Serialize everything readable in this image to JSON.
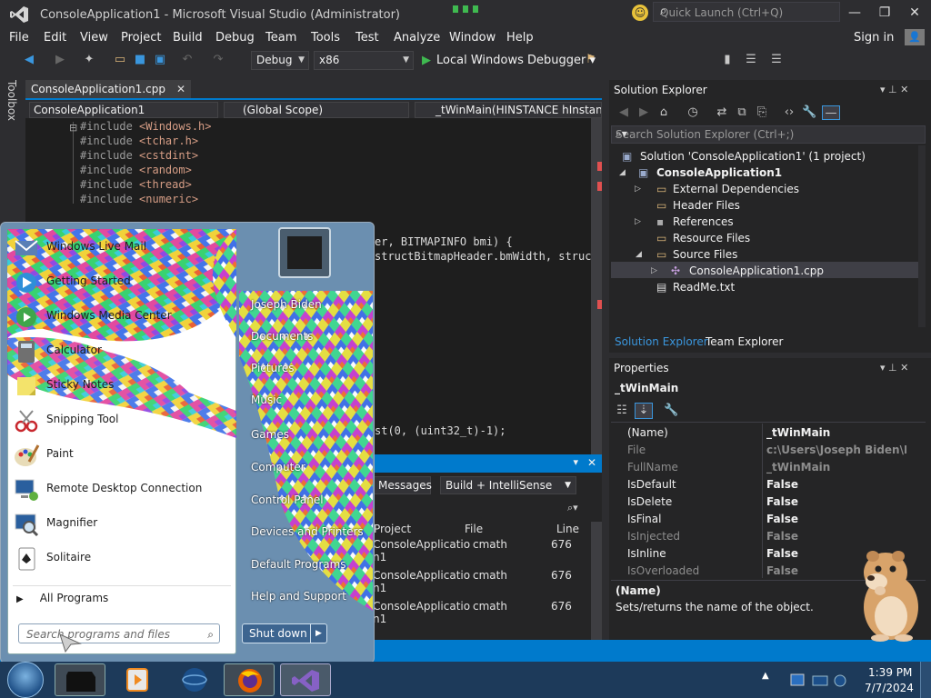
{
  "window": {
    "title": "ConsoleApplication1 - Microsoft Visual Studio (Administrator)",
    "quick_launch_placeholder": "Quick Launch (Ctrl+Q)",
    "sign_in": "Sign in"
  },
  "menu": [
    "File",
    "Edit",
    "View",
    "Project",
    "Build",
    "Debug",
    "Team",
    "Tools",
    "Test",
    "Analyze",
    "Window",
    "Help"
  ],
  "toolbar": {
    "config": "Debug",
    "platform": "x86",
    "debugger": "Local Windows Debugger"
  },
  "toolbox_label": "Toolbox",
  "editor": {
    "tab": "ConsoleApplication1.cpp",
    "nav_project": "ConsoleApplication1",
    "nav_scope": "(Global Scope)",
    "nav_function": "_tWinMain(HINSTANCE hInstanc",
    "lines": [
      {
        "kw": "#include",
        "arg": " <Windows.h>"
      },
      {
        "kw": "#include",
        "arg": " <tchar.h>"
      },
      {
        "kw": "#include",
        "arg": " <cstdint>"
      },
      {
        "kw": "#include",
        "arg": " <random>"
      },
      {
        "kw": "#include",
        "arg": " <thread>"
      },
      {
        "kw": "#include",
        "arg": " <numeric>"
      }
    ],
    "fragment1": "er, BITMAPINFO bmi) {",
    "fragment2": "structBitmapHeader.bmWidth, struct",
    "fragment3": "st(0, (uint32_t)-1);"
  },
  "error_list": {
    "tab_messages": "Messages",
    "filter": "Build + IntelliSense",
    "columns": [
      "Project",
      "File",
      "Line"
    ],
    "rows": [
      {
        "project": "ConsoleApplicatio",
        "project2": "n1",
        "file": "cmath",
        "line": "676"
      },
      {
        "project": "ConsoleApplicatio",
        "project2": "n1",
        "file": "cmath",
        "line": "676"
      },
      {
        "project": "ConsoleApplicatio",
        "project2": "n1",
        "file": "cmath",
        "line": "676"
      }
    ]
  },
  "solution_explorer": {
    "title": "Solution Explorer",
    "search_placeholder": "Search Solution Explorer (Ctrl+;)",
    "solution": "Solution 'ConsoleApplication1' (1 project)",
    "project": "ConsoleApplication1",
    "nodes": [
      "External Dependencies",
      "Header Files",
      "References",
      "Resource Files",
      "Source Files"
    ],
    "source_file": "ConsoleApplication1.cpp",
    "readme": "ReadMe.txt",
    "bottom_tabs": [
      "Solution Explorer",
      "Team Explorer"
    ]
  },
  "properties": {
    "title": "Properties",
    "object": "_tWinMain",
    "rows": [
      {
        "name": "(Name)",
        "value": "_tWinMain",
        "dim": false
      },
      {
        "name": "File",
        "value": "c:\\Users\\Joseph Biden\\Docu",
        "dim": true
      },
      {
        "name": "FullName",
        "value": "_tWinMain",
        "dim": true
      },
      {
        "name": "IsDefault",
        "value": "False",
        "dim": false
      },
      {
        "name": "IsDelete",
        "value": "False",
        "dim": false
      },
      {
        "name": "IsFinal",
        "value": "False",
        "dim": false
      },
      {
        "name": "IsInjected",
        "value": "False",
        "dim": true
      },
      {
        "name": "IsInline",
        "value": "False",
        "dim": false
      },
      {
        "name": "IsOverloaded",
        "value": "False",
        "dim": true
      }
    ],
    "desc_title": "(Name)",
    "desc_text": "Sets/returns the name of the object."
  },
  "start_menu": {
    "programs": [
      "Windows Live Mail",
      "Getting Started",
      "Windows Media Center",
      "Calculator",
      "Sticky Notes",
      "Snipping Tool",
      "Paint",
      "Remote Desktop Connection",
      "Magnifier",
      "Solitaire"
    ],
    "right_items": [
      "Joseph Biden",
      "Documents",
      "Pictures",
      "Music",
      "Games",
      "Computer",
      "Control Panel",
      "Devices and Printers",
      "Default Programs",
      "Help and Support"
    ],
    "all_programs": "All Programs",
    "search_placeholder": "Search programs and files",
    "shutdown": "Shut down"
  },
  "taskbar": {
    "time": "1:39 PM",
    "date": "7/7/2024"
  },
  "colors": {
    "accent": "#007acc",
    "ide_bg": "#2d2d30",
    "editor_bg": "#1e1e1e",
    "taskbar": "#1d3a5a"
  }
}
